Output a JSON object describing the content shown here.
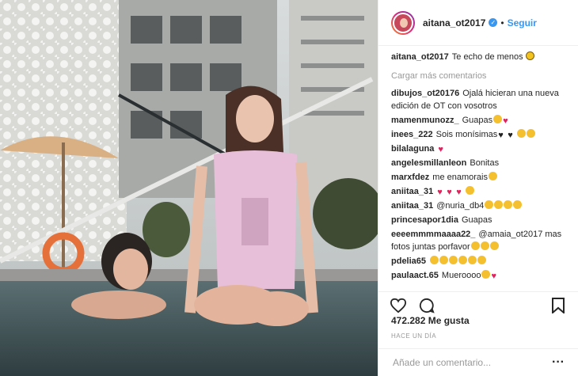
{
  "header": {
    "username": "aitana_ot2017",
    "follow_label": "Seguir",
    "separator": "•"
  },
  "caption": {
    "username": "aitana_ot2017",
    "text": "Te echo de menos"
  },
  "load_more": "Cargar más comentarios",
  "comments": [
    {
      "user": "dibujos_ot20176",
      "text": "Ojalá hicieran una nueva edición de OT con vosotros",
      "emoji": []
    },
    {
      "user": "mamenmunozz_",
      "text": "Guapas",
      "emoji": [
        "face",
        "heart"
      ]
    },
    {
      "user": "inees_222",
      "text": "Sois monísimas",
      "emoji": [
        "bheart",
        "bheart",
        "face",
        "face"
      ]
    },
    {
      "user": "bilalaguna",
      "text": "",
      "emoji": [
        "heart"
      ]
    },
    {
      "user": "angelesmillanleon",
      "text": "Bonitas",
      "emoji": []
    },
    {
      "user": "marxfdez",
      "text": "me enamorais",
      "emoji": [
        "face"
      ]
    },
    {
      "user": "aniitaa_31",
      "text": "",
      "emoji": [
        "heart",
        "heart",
        "heart",
        "face"
      ]
    },
    {
      "user": "aniitaa_31",
      "text": "@nuria_db4",
      "emoji": [
        "face",
        "face",
        "face",
        "face"
      ]
    },
    {
      "user": "princesapor1dia",
      "text": "Guapas",
      "emoji": []
    },
    {
      "user": "eeeemmmmaaaa22_",
      "text": "@amaia_ot2017 mas fotos juntas porfavor",
      "emoji": [
        "face",
        "face",
        "face"
      ]
    },
    {
      "user": "pdelia65",
      "text": "",
      "emoji": [
        "face",
        "face",
        "face",
        "face",
        "face",
        "face"
      ]
    },
    {
      "user": "paulaact.65",
      "text": "Mueroooo",
      "emoji": [
        "face",
        "heart"
      ]
    }
  ],
  "likes": "472.282 Me gusta",
  "timestamp": "HACE UN DÍA",
  "add_comment_placeholder": "Añade un comentario...",
  "icons": {
    "like": "heart-outline-icon",
    "comment": "speech-bubble-icon",
    "save": "bookmark-icon",
    "options": "ellipsis-icon"
  },
  "colors": {
    "link": "#3897f0",
    "text": "#262626",
    "muted": "#999999",
    "border": "#efefef"
  }
}
